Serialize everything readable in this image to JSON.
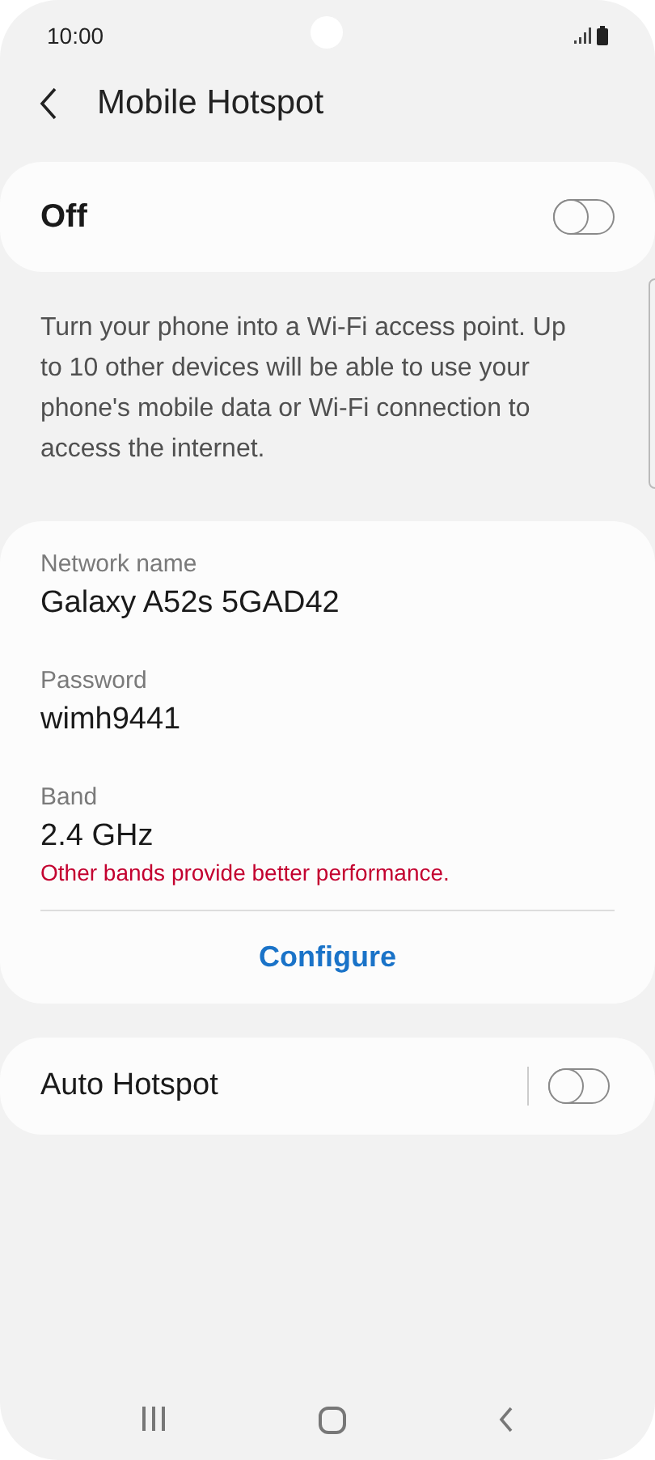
{
  "status_bar": {
    "time": "10:00"
  },
  "header": {
    "title": "Mobile Hotspot"
  },
  "master_switch": {
    "label": "Off",
    "on": false
  },
  "description": "Turn your phone into a Wi-Fi access point. Up to 10 other devices will be able to use your phone's mobile data or Wi-Fi connection to access the internet.",
  "settings": [
    {
      "label": "Network name",
      "value": "Galaxy A52s 5GAD42"
    },
    {
      "label": "Password",
      "value": "wimh9441"
    },
    {
      "label": "Band",
      "value": "2.4 GHz",
      "warning": "Other bands provide better performance."
    }
  ],
  "configure_button": "Configure",
  "auto_hotspot": {
    "label": "Auto Hotspot",
    "on": false
  }
}
